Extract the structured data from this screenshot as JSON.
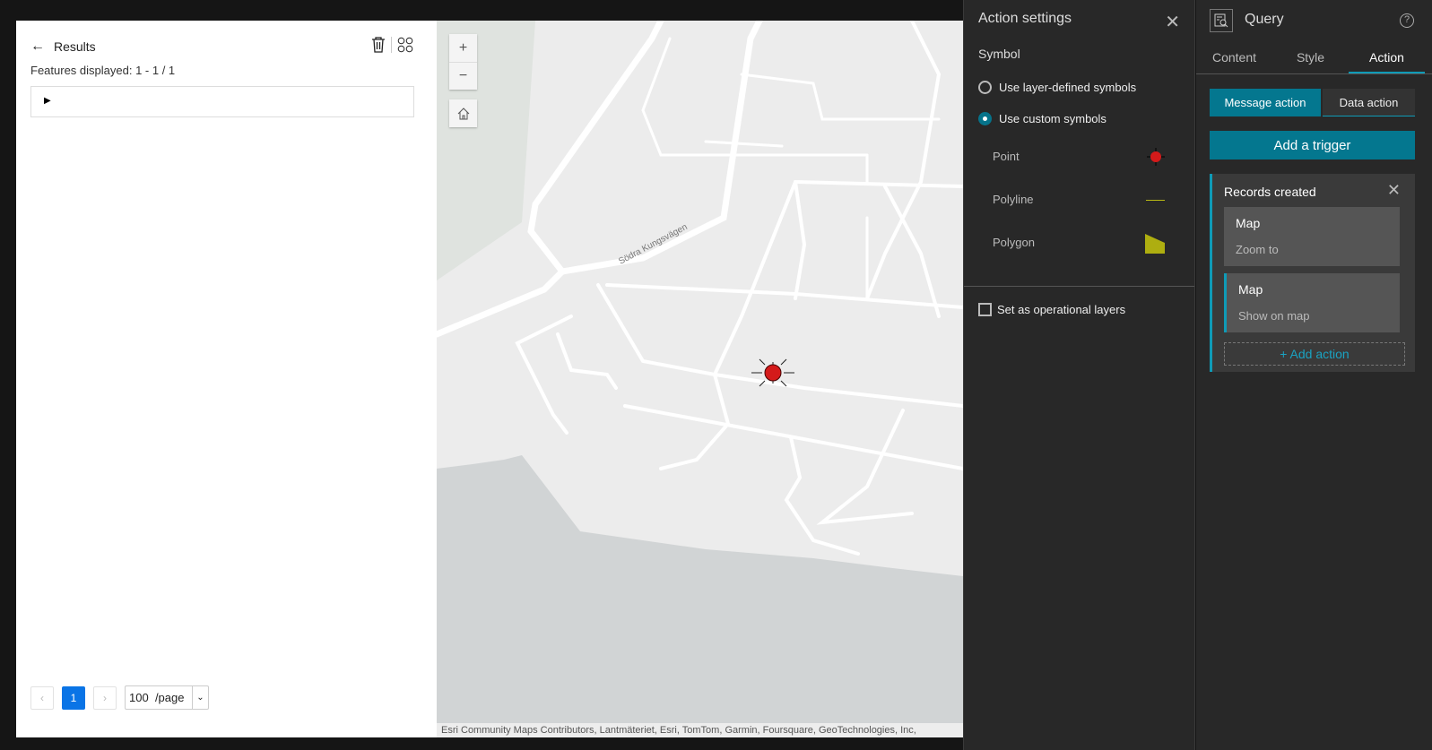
{
  "results": {
    "title": "Results",
    "count": "Features displayed: 1 - 1 / 1",
    "page": "1",
    "page_size": "100",
    "page_unit": "/page"
  },
  "map": {
    "road_label": "Södra Kungsvägen",
    "attribution": "Esri Community Maps Contributors, Lantmäteriet, Esri, TomTom, Garmin, Foursquare, GeoTechnologies, Inc,",
    "zoom_in": "+",
    "zoom_out": "−"
  },
  "settings": {
    "title": "Action settings",
    "symbol": "Symbol",
    "opt_layer": "Use layer-defined symbols",
    "opt_custom": "Use custom symbols",
    "point": "Point",
    "polyline": "Polyline",
    "polygon": "Polygon",
    "operational": "Set as operational layers",
    "colors": {
      "point": "#d41a1a",
      "polyline": "#b8b814",
      "polygon": "#aeae10"
    }
  },
  "query": {
    "title": "Query",
    "tabs": [
      "Content",
      "Style",
      "Action"
    ],
    "message_action": "Message action",
    "data_action": "Data action",
    "add_trigger": "Add a trigger",
    "trigger": "Records created",
    "actions": [
      {
        "target": "Map",
        "action": "Zoom to"
      },
      {
        "target": "Map",
        "action": "Show on map"
      }
    ],
    "add_action": "+ Add action"
  }
}
